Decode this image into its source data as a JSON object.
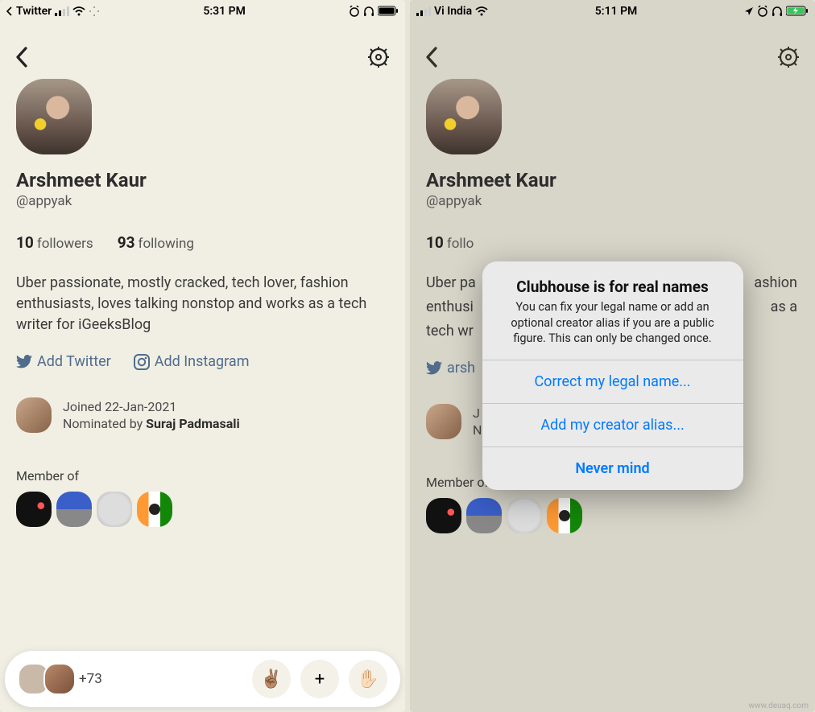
{
  "left": {
    "status": {
      "carrier": "Twitter",
      "time": "5:31 PM"
    },
    "profile": {
      "name": "Arshmeet Kaur",
      "handle": "@appyak",
      "followers_count": "10",
      "followers_label": "followers",
      "following_count": "93",
      "following_label": "following",
      "bio": "Uber passionate, mostly cracked, tech lover, fashion enthusiasts, loves talking nonstop and works as a tech writer for iGeeksBlog",
      "twitter_link": "Add Twitter",
      "instagram_link": "Add Instagram",
      "joined": "Joined 22-Jan-2021",
      "nominated_prefix": "Nominated by ",
      "nominated_by": "Suraj Padmasali",
      "member_of_label": "Member of"
    },
    "bottom": {
      "extra_count": "+73",
      "emoji": "✌🏽",
      "plus": "+",
      "hand": "✋🏻"
    }
  },
  "right": {
    "status": {
      "carrier": "Vi India",
      "time": "5:11 PM"
    },
    "profile": {
      "name": "Arshmeet Kaur",
      "handle": "@appyak",
      "followers_count": "10",
      "followers_label": "follo",
      "bio_line1": "Uber pa",
      "bio_line2": "enthusi",
      "bio_line3": "tech wr",
      "bio_tail1": "ashion",
      "bio_tail2": "as a",
      "twitter_handle": "arsh",
      "joined_short": "J",
      "nominated_short": "N",
      "member_of_label": "Member of"
    },
    "alert": {
      "title": "Clubhouse is for real names",
      "body": "You can fix your legal name or add an optional creator alias if you are a public figure. This can only be changed once.",
      "btn1": "Correct my legal name...",
      "btn2": "Add my creator alias...",
      "btn3": "Never mind"
    }
  },
  "watermark": "www.deuaq.com"
}
